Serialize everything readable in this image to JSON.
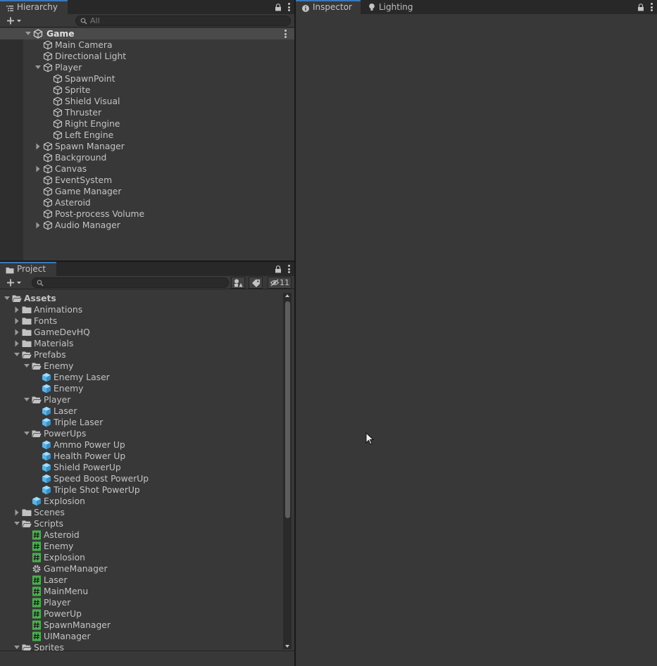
{
  "hierarchy": {
    "tab_label": "Hierarchy",
    "search_placeholder": "All",
    "scene": "Game",
    "items": [
      {
        "label": "Main Camera",
        "depth": 1,
        "expand": "none"
      },
      {
        "label": "Directional Light",
        "depth": 1,
        "expand": "none"
      },
      {
        "label": "Player",
        "depth": 1,
        "expand": "open"
      },
      {
        "label": "SpawnPoint",
        "depth": 2,
        "expand": "none"
      },
      {
        "label": "Sprite",
        "depth": 2,
        "expand": "none"
      },
      {
        "label": "Shield Visual",
        "depth": 2,
        "expand": "none"
      },
      {
        "label": "Thruster",
        "depth": 2,
        "expand": "none"
      },
      {
        "label": "Right Engine",
        "depth": 2,
        "expand": "none"
      },
      {
        "label": "Left Engine",
        "depth": 2,
        "expand": "none"
      },
      {
        "label": "Spawn Manager",
        "depth": 1,
        "expand": "closed"
      },
      {
        "label": "Background",
        "depth": 1,
        "expand": "none"
      },
      {
        "label": "Canvas",
        "depth": 1,
        "expand": "closed"
      },
      {
        "label": "EventSystem",
        "depth": 1,
        "expand": "none"
      },
      {
        "label": "Game Manager",
        "depth": 1,
        "expand": "none"
      },
      {
        "label": "Asteroid",
        "depth": 1,
        "expand": "none"
      },
      {
        "label": "Post-process Volume",
        "depth": 1,
        "expand": "none"
      },
      {
        "label": "Audio Manager",
        "depth": 1,
        "expand": "closed"
      }
    ]
  },
  "project": {
    "tab_label": "Project",
    "hidden_count": "11",
    "items": [
      {
        "label": "Assets",
        "depth": 0,
        "expand": "open",
        "icon": "folder-open-icon",
        "bold": true
      },
      {
        "label": "Animations",
        "depth": 1,
        "expand": "closed",
        "icon": "folder-icon"
      },
      {
        "label": "Fonts",
        "depth": 1,
        "expand": "closed",
        "icon": "folder-icon"
      },
      {
        "label": "GameDevHQ",
        "depth": 1,
        "expand": "closed",
        "icon": "folder-icon"
      },
      {
        "label": "Materials",
        "depth": 1,
        "expand": "closed",
        "icon": "folder-icon"
      },
      {
        "label": "Prefabs",
        "depth": 1,
        "expand": "open",
        "icon": "folder-open-icon"
      },
      {
        "label": "Enemy",
        "depth": 2,
        "expand": "open",
        "icon": "folder-open-icon"
      },
      {
        "label": "Enemy Laser",
        "depth": 3,
        "expand": "none",
        "icon": "prefab-icon"
      },
      {
        "label": "Enemy",
        "depth": 3,
        "expand": "none",
        "icon": "prefab-icon"
      },
      {
        "label": "Player",
        "depth": 2,
        "expand": "open",
        "icon": "folder-open-icon"
      },
      {
        "label": "Laser",
        "depth": 3,
        "expand": "none",
        "icon": "prefab-icon"
      },
      {
        "label": "Triple Laser",
        "depth": 3,
        "expand": "none",
        "icon": "prefab-icon"
      },
      {
        "label": "PowerUps",
        "depth": 2,
        "expand": "open",
        "icon": "folder-open-icon"
      },
      {
        "label": "Ammo Power Up",
        "depth": 3,
        "expand": "none",
        "icon": "prefab-icon"
      },
      {
        "label": "Health Power Up",
        "depth": 3,
        "expand": "none",
        "icon": "prefab-icon"
      },
      {
        "label": "Shield PowerUp",
        "depth": 3,
        "expand": "none",
        "icon": "prefab-icon"
      },
      {
        "label": "Speed Boost PowerUp",
        "depth": 3,
        "expand": "none",
        "icon": "prefab-icon"
      },
      {
        "label": "Triple Shot PowerUp",
        "depth": 3,
        "expand": "none",
        "icon": "prefab-icon"
      },
      {
        "label": "Explosion",
        "depth": 2,
        "expand": "none",
        "icon": "prefab-icon"
      },
      {
        "label": "Scenes",
        "depth": 1,
        "expand": "closed",
        "icon": "folder-icon"
      },
      {
        "label": "Scripts",
        "depth": 1,
        "expand": "open",
        "icon": "folder-open-icon"
      },
      {
        "label": "Asteroid",
        "depth": 2,
        "expand": "none",
        "icon": "script-icon"
      },
      {
        "label": "Enemy",
        "depth": 2,
        "expand": "none",
        "icon": "script-icon"
      },
      {
        "label": "Explosion",
        "depth": 2,
        "expand": "none",
        "icon": "script-icon"
      },
      {
        "label": "GameManager",
        "depth": 2,
        "expand": "none",
        "icon": "gear-icon"
      },
      {
        "label": "Laser",
        "depth": 2,
        "expand": "none",
        "icon": "script-icon"
      },
      {
        "label": "MainMenu",
        "depth": 2,
        "expand": "none",
        "icon": "script-icon"
      },
      {
        "label": "Player",
        "depth": 2,
        "expand": "none",
        "icon": "script-icon"
      },
      {
        "label": "PowerUp",
        "depth": 2,
        "expand": "none",
        "icon": "script-icon"
      },
      {
        "label": "SpawnManager",
        "depth": 2,
        "expand": "none",
        "icon": "script-icon"
      },
      {
        "label": "UIManager",
        "depth": 2,
        "expand": "none",
        "icon": "script-icon"
      },
      {
        "label": "Sprites",
        "depth": 1,
        "expand": "open",
        "icon": "folder-open-icon"
      }
    ]
  },
  "inspector": {
    "tab_label": "Inspector",
    "lighting_tab_label": "Lighting"
  },
  "colors": {
    "panel": "#383838",
    "tab_bar": "#282828",
    "accent": "#3a79bb",
    "prefab": "#59b4e8",
    "script": "#4caf50"
  }
}
